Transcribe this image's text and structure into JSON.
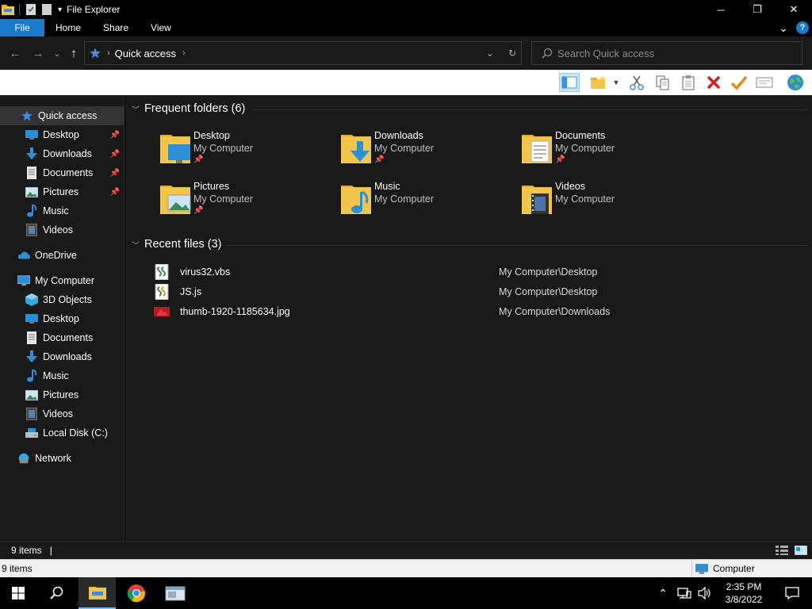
{
  "window": {
    "title": "File Explorer",
    "controls": {
      "minimize": "─",
      "maximize": "❐",
      "close": "✕"
    }
  },
  "ribbon": {
    "tabs": [
      "File",
      "Home",
      "Share",
      "View"
    ],
    "expand_glyph": "⌄",
    "help_glyph": "?"
  },
  "nav": {
    "back": "←",
    "forward": "→",
    "recent": "⌄",
    "up": "↑",
    "breadcrumb": "Quick access",
    "breadcrumb_sep": "›",
    "dropdown": "⌄",
    "refresh": "↻"
  },
  "search": {
    "placeholder": "Search Quick access",
    "value": ""
  },
  "sidebar": {
    "items": [
      {
        "label": "Quick access",
        "icon": "star-icon",
        "pinned": false
      },
      {
        "label": "Desktop",
        "icon": "desktop-icon",
        "pinned": true
      },
      {
        "label": "Downloads",
        "icon": "downloads-icon",
        "pinned": true
      },
      {
        "label": "Documents",
        "icon": "documents-icon",
        "pinned": true
      },
      {
        "label": "Pictures",
        "icon": "pictures-icon",
        "pinned": true
      },
      {
        "label": "Music",
        "icon": "music-icon",
        "pinned": false
      },
      {
        "label": "Videos",
        "icon": "videos-icon",
        "pinned": false
      },
      {
        "label": "OneDrive",
        "icon": "cloud-icon",
        "pinned": false
      },
      {
        "label": "My Computer",
        "icon": "computer-icon",
        "pinned": false
      },
      {
        "label": "3D Objects",
        "icon": "cube-icon",
        "pinned": false
      },
      {
        "label": "Desktop",
        "icon": "desktop-icon",
        "pinned": false
      },
      {
        "label": "Documents",
        "icon": "documents-icon",
        "pinned": false
      },
      {
        "label": "Downloads",
        "icon": "downloads-icon",
        "pinned": false
      },
      {
        "label": "Music",
        "icon": "music-icon",
        "pinned": false
      },
      {
        "label": "Pictures",
        "icon": "pictures-icon",
        "pinned": false
      },
      {
        "label": "Videos",
        "icon": "videos-icon",
        "pinned": false
      },
      {
        "label": "Local Disk (C:)",
        "icon": "drive-icon",
        "pinned": false
      },
      {
        "label": "Network",
        "icon": "network-icon",
        "pinned": false
      }
    ],
    "pin_glyph": "📌"
  },
  "frequent": {
    "heading": "Frequent folders (6)",
    "folders": [
      {
        "name": "Desktop",
        "location": "My Computer",
        "pinned": true
      },
      {
        "name": "Downloads",
        "location": "My Computer",
        "pinned": true
      },
      {
        "name": "Documents",
        "location": "My Computer",
        "pinned": true
      },
      {
        "name": "Pictures",
        "location": "My Computer",
        "pinned": true
      },
      {
        "name": "Music",
        "location": "My Computer",
        "pinned": false
      },
      {
        "name": "Videos",
        "location": "My Computer",
        "pinned": false
      }
    ]
  },
  "recent": {
    "heading": "Recent files (3)",
    "files": [
      {
        "name": "virus32.vbs",
        "path": "My Computer\\Desktop",
        "icon": "script-file-icon"
      },
      {
        "name": "JS.js",
        "path": "My Computer\\Desktop",
        "icon": "js-file-icon"
      },
      {
        "name": "thumb-1920-1185634.jpg",
        "path": "My Computer\\Downloads",
        "icon": "image-file-icon"
      }
    ]
  },
  "status": {
    "count": "9 items",
    "count2": "9 items",
    "zone": "Computer"
  },
  "taskbar": {
    "clock_time": "2:35 PM",
    "clock_date": "3/8/2022"
  },
  "colors": {
    "accent": "#1979ca",
    "background": "#191919",
    "folder_yellow": "#f3c64a"
  }
}
